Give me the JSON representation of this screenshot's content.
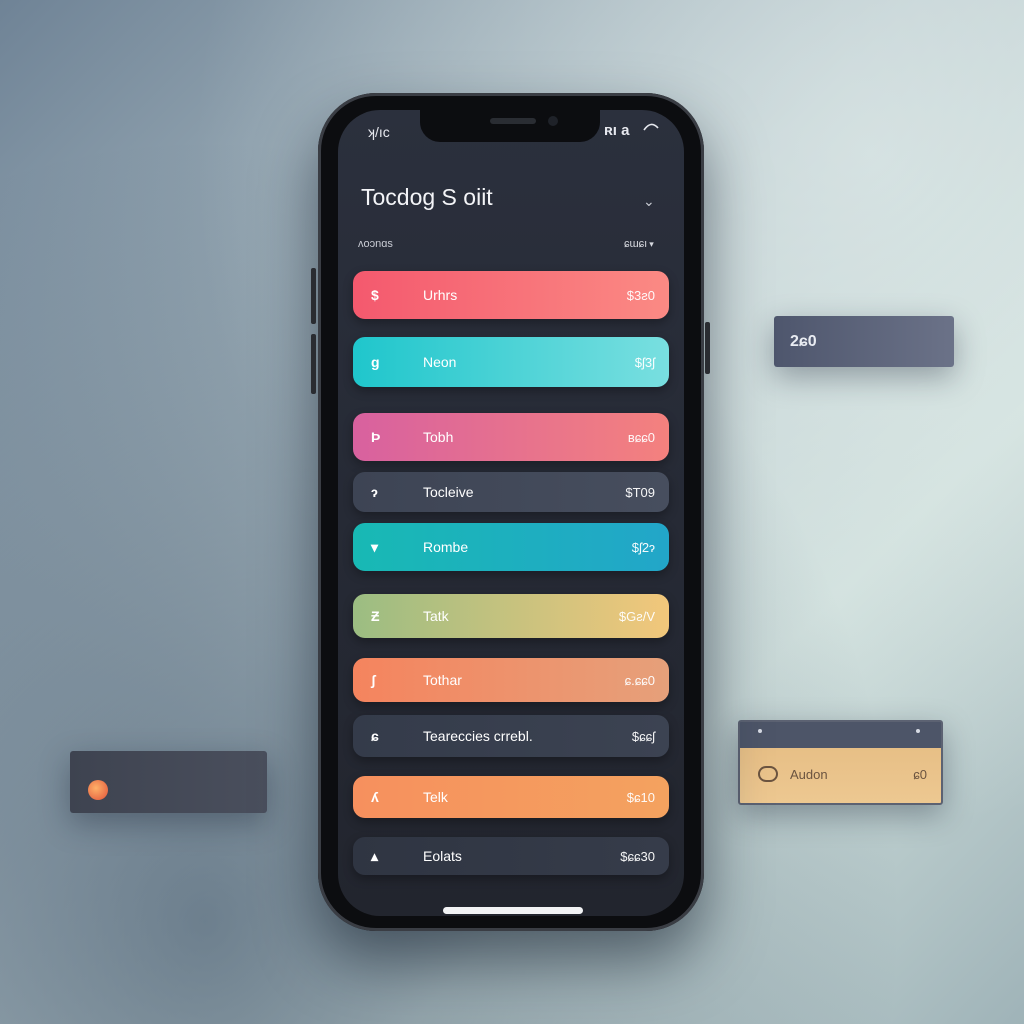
{
  "status_bar": {
    "left": "ʞ/ıc",
    "right": "ʀı a"
  },
  "header": {
    "title": "Tocdog S  oiit",
    "subtitle_left": "ʌoɔnɑs",
    "subtitle_right": "ɕɯɕı"
  },
  "tasks": [
    {
      "icon": "$",
      "label": "Urhrs",
      "amount": "$3ƨ0",
      "gradient": [
        "#f4596e",
        "#fb8a84"
      ]
    },
    {
      "icon": "g",
      "label": "Neon",
      "amount": "$ʃ3ʃ",
      "gradient": [
        "#1fc6cc",
        "#79dfe0"
      ]
    },
    {
      "icon": "Ϸ",
      "label": "Tobh",
      "amount": "ʙɕɕ0",
      "gradient": [
        "#d8619f",
        "#f4817e"
      ]
    },
    {
      "icon": "ɂ",
      "label": "Tocleive",
      "amount": "$T09",
      "gradient": [
        "#3d4454",
        "#474e5e"
      ]
    },
    {
      "icon": "▾",
      "label": "Rombe",
      "amount": "$ʃ2ɂ",
      "gradient": [
        "#18b9b4",
        "#22a6c9"
      ]
    },
    {
      "icon": "Ƶ",
      "label": "Tatk",
      "amount": "$Gƨ/V",
      "gradient": [
        "#9bbd82",
        "#f2c77b"
      ]
    },
    {
      "icon": "ʃ",
      "label": "Tothar",
      "amount": "ɕ.ɕɕ0",
      "gradient": [
        "#f5845e",
        "#e6a07a"
      ]
    },
    {
      "icon": "ɕ",
      "label": "Teareccies crrebl.",
      "amount": "$ɕɕʃ",
      "gradient": [
        "#343b4a",
        "#3c4352"
      ]
    },
    {
      "icon": "ʎ",
      "label": "Telk",
      "amount": "$ɕ10",
      "gradient": [
        "#f6905e",
        "#f4a25f"
      ]
    },
    {
      "icon": "▴",
      "label": "Eolats",
      "amount": "$ɕɕ30",
      "gradient": [
        "#2f3542",
        "#363c4a"
      ]
    }
  ],
  "floating": {
    "card_a_value": "2ɕ0",
    "card_c_label": "Audon",
    "card_c_value": "ɕ0"
  }
}
